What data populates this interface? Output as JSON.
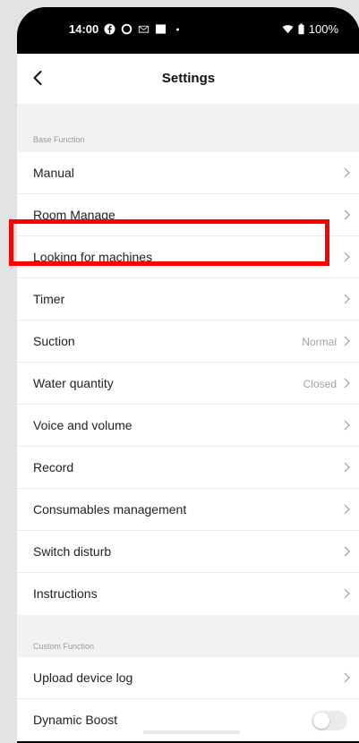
{
  "status_bar": {
    "time": "14:00",
    "battery": "100%",
    "icons": [
      "facebook-icon",
      "circle-icon",
      "gmail-icon",
      "square-icon",
      "dot-icon",
      "wifi-icon",
      "battery-icon"
    ]
  },
  "header": {
    "title": "Settings",
    "back_icon": "back-arrow-icon"
  },
  "sections": {
    "base_function": "Base Function",
    "custom_function": "Custom Function"
  },
  "rows": {
    "manual": "Manual",
    "room_manage": "Room Manage",
    "looking_for_machines": "Looking for machines",
    "timer": "Timer",
    "suction": "Suction",
    "suction_value": "Normal",
    "water_quantity": "Water quantity",
    "water_quantity_value": "Closed",
    "voice_and_volume": "Voice and volume",
    "record": "Record",
    "consumables_management": "Consumables management",
    "switch_disturb": "Switch disturb",
    "instructions": "Instructions",
    "upload_device_log": "Upload device log",
    "dynamic_boost": "Dynamic Boost"
  },
  "toggles": {
    "dynamic_boost_on": false
  },
  "colors": {
    "highlight": "#ff0000",
    "section_bg": "#f2f2f2",
    "section_text": "#9a9a9a",
    "value_text": "#a2a2a2"
  }
}
